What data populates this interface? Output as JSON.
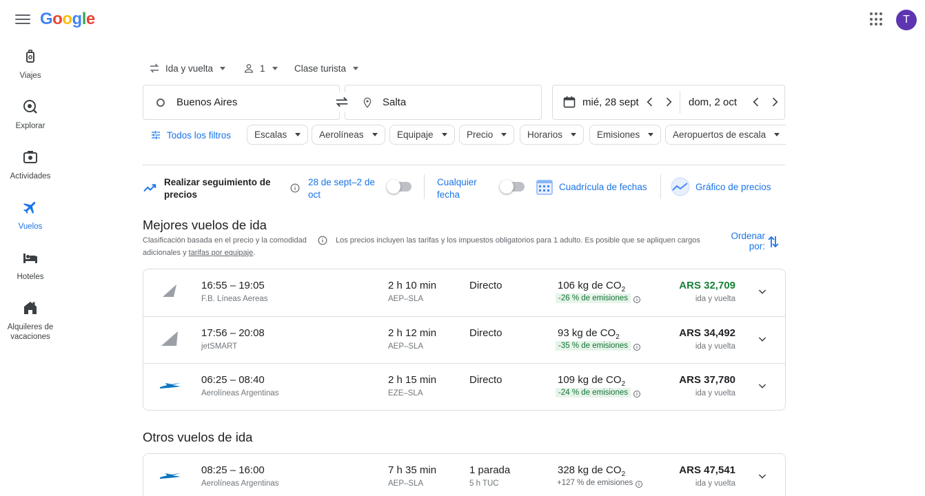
{
  "header": {
    "logo_text": "Google",
    "avatar_letter": "T",
    "colors": {
      "avatar": "#5e35b1",
      "accent": "#1a73e8"
    }
  },
  "sidebar": {
    "items": [
      {
        "label": "Viajes",
        "icon": "luggage-icon"
      },
      {
        "label": "Explorar",
        "icon": "explore-icon"
      },
      {
        "label": "Actividades",
        "icon": "camera-icon"
      },
      {
        "label": "Vuelos",
        "icon": "flight-icon",
        "active": true
      },
      {
        "label": "Hoteles",
        "icon": "bed-icon"
      },
      {
        "label": "Alquileres de vacaciones",
        "icon": "house-icon"
      }
    ]
  },
  "search": {
    "trip_type": "Ida y vuelta",
    "passengers": "1",
    "cabin_class": "Clase turista",
    "origin": "Buenos Aires",
    "destination": "Salta",
    "depart_date": "mié, 28 sept",
    "return_date": "dom, 2 oct"
  },
  "filters": {
    "all_filters": "Todos los filtros",
    "chips": [
      "Escalas",
      "Aerolíneas",
      "Equipaje",
      "Precio",
      "Horarios",
      "Emisiones",
      "Aeropuertos de escala"
    ]
  },
  "tracking": {
    "label": "Realizar seguimiento de precios",
    "date_range": "28 de sept–2 de oct",
    "any_date": "Cualquier fecha",
    "date_grid": "Cuadrícula de fechas",
    "price_graph": "Gráfico de precios"
  },
  "best": {
    "title": "Mejores vuelos de ida",
    "note_ranking": "Clasificación basada en el precio y la comodidad",
    "note_prices": "Los precios incluyen las tarifas y los impuestos obligatorios para 1 adulto. Es posible que se apliquen cargos",
    "note_prices_2": "adicionales y",
    "note_link": "tarifas por equipaje",
    "note_end": ".",
    "sort_label": "Ordenar por:",
    "flights": [
      {
        "times": "16:55 – 19:05",
        "airline": "F.B. Líneas Aereas",
        "duration": "2 h 10 min",
        "route": "AEP–SLA",
        "stops": "Directo",
        "stop_info": "",
        "co2": "106 kg de CO",
        "co2_sub": "2",
        "emissions": "-26 % de emisiones",
        "price": "ARS 32,709",
        "price_type": "ida y vuelta",
        "logo": "tail-gray"
      },
      {
        "times": "17:56 – 20:08",
        "airline": "jetSMART",
        "duration": "2 h 12 min",
        "route": "AEP–SLA",
        "stops": "Directo",
        "stop_info": "",
        "co2": "93 kg de CO",
        "co2_sub": "2",
        "emissions": "-35 % de emisiones",
        "price": "ARS 34,492",
        "price_type": "ida y vuelta",
        "logo": "tail-gray"
      },
      {
        "times": "06:25 – 08:40",
        "airline": "Aerolíneas Argentinas",
        "duration": "2 h 15 min",
        "route": "EZE–SLA",
        "stops": "Directo",
        "stop_info": "",
        "co2": "109 kg de CO",
        "co2_sub": "2",
        "emissions": "-24 % de emisiones",
        "price": "ARS 37,780",
        "price_type": "ida y vuelta",
        "logo": "aerolineas"
      }
    ]
  },
  "others": {
    "title": "Otros vuelos de ida",
    "flights": [
      {
        "times": "08:25 – 16:00",
        "airline": "Aerolíneas Argentinas",
        "duration": "7 h 35 min",
        "route": "AEP–SLA",
        "stops": "1 parada",
        "stop_info": "5 h TUC",
        "co2": "328 kg de CO",
        "co2_sub": "2",
        "emissions": "+127 % de emisiones",
        "price": "ARS 47,541",
        "price_type": "ida y vuelta",
        "logo": "aerolineas"
      }
    ]
  }
}
